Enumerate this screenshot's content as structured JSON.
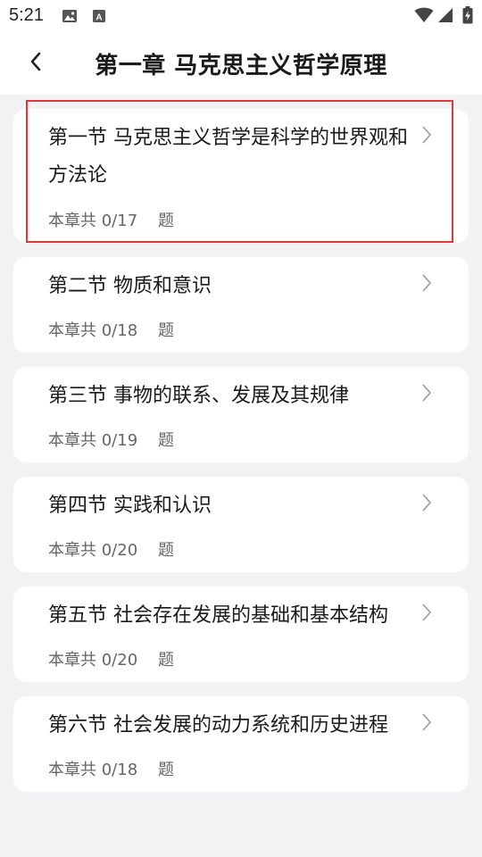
{
  "status_bar": {
    "time": "5:21",
    "icons": [
      "gallery-icon",
      "a-icon",
      "wifi-icon",
      "signal-icon",
      "battery-icon"
    ]
  },
  "header": {
    "back_icon": "chevron-left-icon",
    "title": "第一章 马克思主义哲学原理"
  },
  "sections": [
    {
      "title": "第一节 马克思主义哲学是科学的世界观和方法论",
      "count": "本章共 0/17    题",
      "highlighted": true
    },
    {
      "title": "第二节 物质和意识",
      "count": "本章共 0/18    题"
    },
    {
      "title": "第三节 事物的联系、发展及其规律",
      "count": "本章共 0/19    题"
    },
    {
      "title": "第四节 实践和认识",
      "count": "本章共 0/20    题"
    },
    {
      "title": "第五节 社会存在发展的基础和基本结构",
      "count": "本章共 0/20    题"
    },
    {
      "title": "第六节 社会发展的动力系统和历史进程",
      "count": "本章共 0/18    题"
    }
  ],
  "colors": {
    "background": "#f2f2f4",
    "card": "#ffffff",
    "highlight_border": "#e0393b"
  }
}
